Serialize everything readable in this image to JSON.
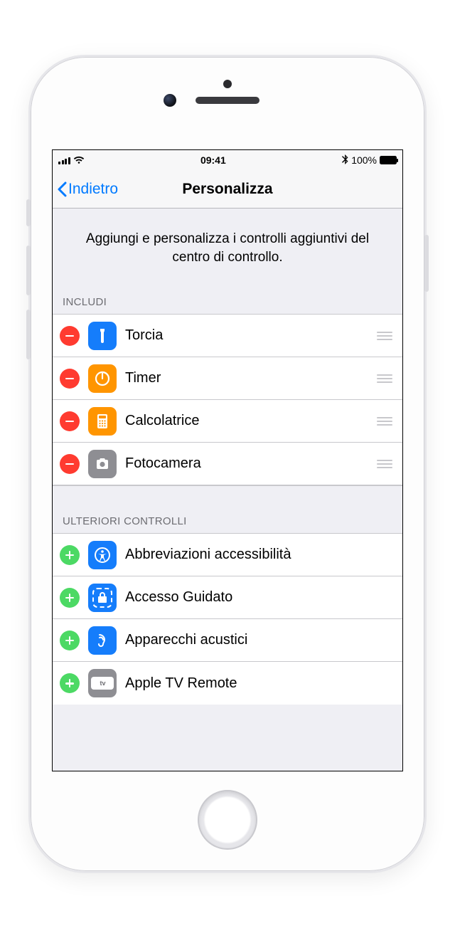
{
  "status": {
    "time": "09:41",
    "battery_pct": "100%"
  },
  "nav": {
    "back_label": "Indietro",
    "title": "Personalizza"
  },
  "description": "Aggiungi e personalizza i controlli aggiuntivi del centro di controllo.",
  "sections": {
    "include_header": "INCLUDI",
    "more_header": "ULTERIORI CONTROLLI"
  },
  "include": [
    {
      "label": "Torcia"
    },
    {
      "label": "Timer"
    },
    {
      "label": "Calcolatrice"
    },
    {
      "label": "Fotocamera"
    }
  ],
  "more": [
    {
      "label": "Abbreviazioni accessibilità"
    },
    {
      "label": "Accesso Guidato"
    },
    {
      "label": "Apparecchi acustici"
    },
    {
      "label": "Apple TV Remote"
    }
  ],
  "atv_badge": "tv"
}
